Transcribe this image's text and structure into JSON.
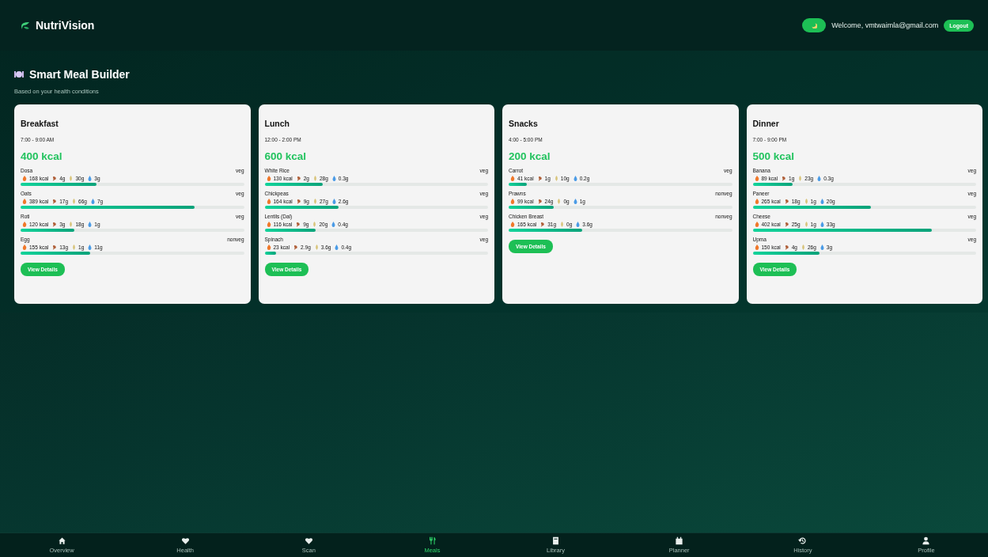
{
  "header": {
    "brand": "NutriVision",
    "welcome": "Welcome, vmtwaimla@gmail.com",
    "logout": "Logout",
    "dark_mode": true
  },
  "section": {
    "title": "Smart Meal Builder",
    "subtitle": "Based on your health conditions"
  },
  "meals": [
    {
      "name": "Breakfast",
      "time": "7:00 - 9:00 AM",
      "kcal": "400 kcal",
      "button": "View Details",
      "foods": [
        {
          "name": "Dosa",
          "type": "veg",
          "kcal": "168 kcal",
          "protein": "4g",
          "carbs": "30g",
          "fat": "3g",
          "level": 0.34
        },
        {
          "name": "Oats",
          "type": "veg",
          "kcal": "389 kcal",
          "protein": "17g",
          "carbs": "66g",
          "fat": "7g",
          "level": 0.78
        },
        {
          "name": "Roti",
          "type": "veg",
          "kcal": "120 kcal",
          "protein": "3g",
          "carbs": "18g",
          "fat": "1g",
          "level": 0.24
        },
        {
          "name": "Egg",
          "type": "nonveg",
          "kcal": "155 kcal",
          "protein": "13g",
          "carbs": "1g",
          "fat": "11g",
          "level": 0.31
        }
      ]
    },
    {
      "name": "Lunch",
      "time": "12:00 - 2:00 PM",
      "kcal": "600 kcal",
      "button": "View Details",
      "foods": [
        {
          "name": "White Rice",
          "type": "veg",
          "kcal": "130 kcal",
          "protein": "2g",
          "carbs": "28g",
          "fat": "0.3g",
          "level": 0.26
        },
        {
          "name": "Chickpeas",
          "type": "veg",
          "kcal": "164 kcal",
          "protein": "9g",
          "carbs": "27g",
          "fat": "2.6g",
          "level": 0.33
        },
        {
          "name": "Lentils (Dal)",
          "type": "veg",
          "kcal": "116 kcal",
          "protein": "9g",
          "carbs": "20g",
          "fat": "0.4g",
          "level": 0.23
        },
        {
          "name": "Spinach",
          "type": "veg",
          "kcal": "23 kcal",
          "protein": "2.9g",
          "carbs": "3.6g",
          "fat": "0.4g",
          "level": 0.05
        }
      ]
    },
    {
      "name": "Snacks",
      "time": "4:00 - 5:00 PM",
      "kcal": "200 kcal",
      "button": "View Details",
      "foods": [
        {
          "name": "Carrot",
          "type": "veg",
          "kcal": "41 kcal",
          "protein": "1g",
          "carbs": "10g",
          "fat": "0.2g",
          "level": 0.08
        },
        {
          "name": "Prawns",
          "type": "nonveg",
          "kcal": "99 kcal",
          "protein": "24g",
          "carbs": "0g",
          "fat": "1g",
          "level": 0.2
        },
        {
          "name": "Chicken Breast",
          "type": "nonveg",
          "kcal": "165 kcal",
          "protein": "31g",
          "carbs": "0g",
          "fat": "3.6g",
          "level": 0.33
        }
      ]
    },
    {
      "name": "Dinner",
      "time": "7:00 - 9:00 PM",
      "kcal": "500 kcal",
      "button": "View Details",
      "foods": [
        {
          "name": "Banana",
          "type": "veg",
          "kcal": "89 kcal",
          "protein": "1g",
          "carbs": "23g",
          "fat": "0.3g",
          "level": 0.18
        },
        {
          "name": "Paneer",
          "type": "veg",
          "kcal": "265 kcal",
          "protein": "18g",
          "carbs": "1g",
          "fat": "20g",
          "level": 0.53
        },
        {
          "name": "Cheese",
          "type": "veg",
          "kcal": "402 kcal",
          "protein": "25g",
          "carbs": "1g",
          "fat": "33g",
          "level": 0.8
        },
        {
          "name": "Upma",
          "type": "veg",
          "kcal": "150 kcal",
          "protein": "4g",
          "carbs": "26g",
          "fat": "3g",
          "level": 0.3
        }
      ]
    }
  ],
  "nav": [
    {
      "label": "Overview",
      "kind": "home",
      "selected": false
    },
    {
      "label": "Health",
      "kind": "heart",
      "selected": false
    },
    {
      "label": "Scan",
      "kind": "heart",
      "selected": false
    },
    {
      "label": "Meals",
      "kind": "utensils",
      "selected": true
    },
    {
      "label": "Library",
      "kind": "book",
      "selected": false
    },
    {
      "label": "Planner",
      "kind": "calendar",
      "selected": false
    },
    {
      "label": "History",
      "kind": "history",
      "selected": false
    },
    {
      "label": "Profile",
      "kind": "person",
      "selected": false
    }
  ]
}
